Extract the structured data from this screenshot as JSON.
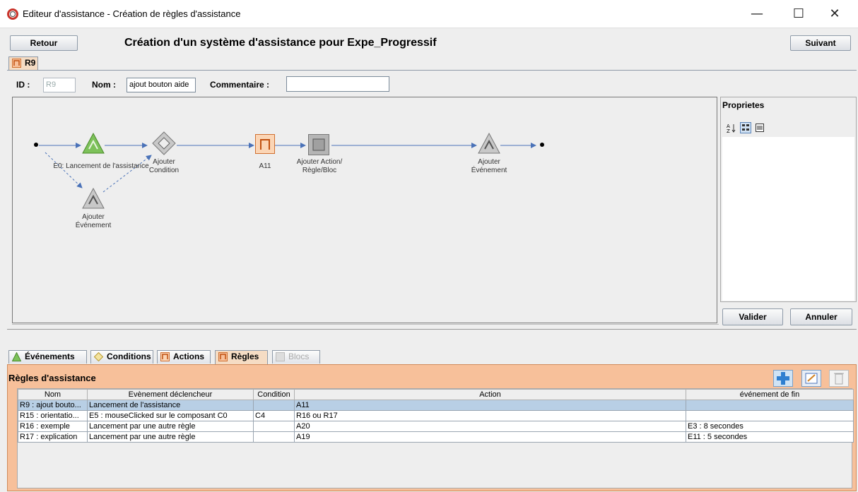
{
  "window": {
    "title": "Editeur d'assistance - Création de règles d'assistance"
  },
  "toolbar": {
    "back_label": "Retour",
    "next_label": "Suivant",
    "heading": "Création d'un système d'assistance pour Expe_Progressif"
  },
  "rule_tab": {
    "label": "R9"
  },
  "form": {
    "id_label": "ID :",
    "id_value": "R9",
    "name_label": "Nom :",
    "name_value": "ajout bouton aide",
    "comment_label": "Commentaire :",
    "comment_value": ""
  },
  "diagram": {
    "nodes": {
      "event": "E0: Lancement de l'assistance",
      "add_condition_1": "Ajouter",
      "add_condition_2": "Condition",
      "action": "A11",
      "add_action_1": "Ajouter Action/",
      "add_action_2": "Règle/Bloc",
      "add_event_end_1": "Ajouter",
      "add_event_end_2": "Événement",
      "add_event_alt_1": "Ajouter",
      "add_event_alt_2": "Événement"
    }
  },
  "properties": {
    "title": "Proprietes"
  },
  "buttons": {
    "validate": "Valider",
    "cancel": "Annuler"
  },
  "bottom_tabs": [
    {
      "label": "Événements"
    },
    {
      "label": "Conditions"
    },
    {
      "label": "Actions"
    },
    {
      "label": "Règles"
    },
    {
      "label": "Blocs"
    }
  ],
  "rules_panel": {
    "title": "Règles d'assistance",
    "columns": [
      "Nom",
      "Evènement déclencheur",
      "Condition",
      "Action",
      "événement de fin"
    ],
    "rows": [
      {
        "nom": "R9 : ajout bouto...",
        "trigger": "Lancement de l'assistance",
        "condition": "",
        "action": "A11",
        "end": ""
      },
      {
        "nom": "R15 : orientatio...",
        "trigger": "E5 : mouseClicked sur le composant C0",
        "condition": "C4",
        "action": "R16 ou R17",
        "end": ""
      },
      {
        "nom": "R16 : exemple",
        "trigger": "Lancement par une autre règle",
        "condition": "",
        "action": "A20",
        "end": "E3 : 8 secondes"
      },
      {
        "nom": "R17 : explication",
        "trigger": "Lancement par une autre règle",
        "condition": "",
        "action": "A19",
        "end": "E11 : 5 secondes"
      }
    ]
  },
  "colors": {
    "accent_orange": "#f7c09a",
    "selection_blue": "#b8cfe5",
    "event_green": "#7dc15a",
    "condition_gray": "#c8c8c8"
  }
}
